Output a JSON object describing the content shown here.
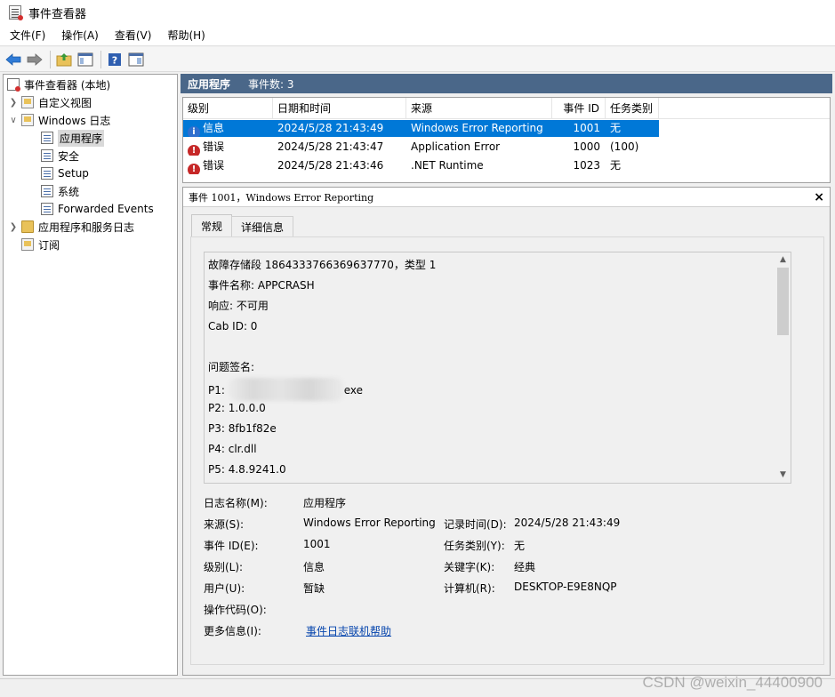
{
  "window": {
    "title": "事件查看器"
  },
  "menu": [
    "文件(F)",
    "操作(A)",
    "查看(V)",
    "帮助(H)"
  ],
  "toolbar": {
    "icons": [
      "back-arrow-icon",
      "forward-arrow-icon",
      "up-folder-icon",
      "show-hide-tree-icon",
      "help-icon",
      "properties-icon"
    ],
    "colors": {
      "arrow": "#2f7bd6",
      "help": "#2f5fb0"
    }
  },
  "tree": {
    "root": "事件查看器 (本地)",
    "custom_views": "自定义视图",
    "windows_logs": "Windows 日志",
    "logs": [
      "应用程序",
      "安全",
      "Setup",
      "系统",
      "Forwarded Events"
    ],
    "app_service_logs": "应用程序和服务日志",
    "subscriptions": "订阅"
  },
  "log_header": {
    "title": "应用程序",
    "count": "事件数: 3",
    "color": "#4a6789"
  },
  "event_table": {
    "columns": [
      "级别",
      "日期和时间",
      "来源",
      "事件 ID",
      "任务类别"
    ],
    "rows": [
      {
        "level": "信息",
        "level_icon": "info-icon",
        "datetime": "2024/5/28 21:43:49",
        "source": "Windows Error Reporting",
        "id": "1001",
        "task": "无"
      },
      {
        "level": "错误",
        "level_icon": "error-icon",
        "datetime": "2024/5/28 21:43:47",
        "source": "Application Error",
        "id": "1000",
        "task": "(100)"
      },
      {
        "level": "错误",
        "level_icon": "error-icon",
        "datetime": "2024/5/28 21:43:46",
        "source": ".NET Runtime",
        "id": "1023",
        "task": "无"
      }
    ],
    "selected_color": "#0078d7"
  },
  "detail": {
    "title": "事件 1001，Windows Error Reporting",
    "close": "×",
    "tabs": [
      "常规",
      "详细信息"
    ],
    "description": {
      "line1": "故障存储段 1864333766369637770，类型 1",
      "line2": "事件名称: APPCRASH",
      "line3": "响应: 不可用",
      "line4": "Cab ID: 0",
      "line5": "问题签名:",
      "p1_prefix": "P1: ",
      "p1_suffix": "exe",
      "line7": "P2: 1.0.0.0",
      "line8": "P3: 8fb1f82e",
      "line9": "P4: clr.dll",
      "line10": "P5: 4.8.9241.0"
    },
    "props": {
      "log_name_label": "日志名称(M):",
      "log_name": "应用程序",
      "source_label": "来源(S):",
      "source": "Windows Error Reporting",
      "logged_label": "记录时间(D):",
      "logged": "2024/5/28 21:43:49",
      "event_id_label": "事件 ID(E):",
      "event_id": "1001",
      "task_label": "任务类别(Y):",
      "task": "无",
      "level_label": "级别(L):",
      "level": "信息",
      "keywords_label": "关键字(K):",
      "keywords": "经典",
      "user_label": "用户(U):",
      "user": "暂缺",
      "computer_label": "计算机(R):",
      "computer": "DESKTOP-E9E8NQP",
      "opcode_label": "操作代码(O):",
      "more_label": "更多信息(I):",
      "more_link": "事件日志联机帮助"
    }
  },
  "watermark": "CSDN @weixin_44400900"
}
